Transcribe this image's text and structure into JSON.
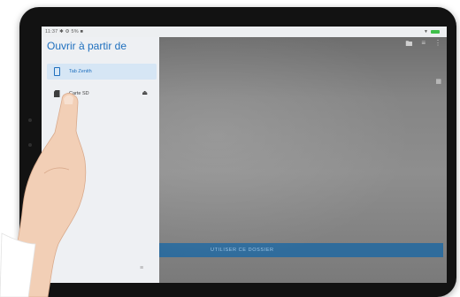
{
  "status_bar": {
    "time": "11:37",
    "indicators": "✱ ⚙ 5% ■"
  },
  "drawer": {
    "title": "Ouvrir à partir de",
    "items": [
      {
        "label": "Tab Zenith",
        "icon": "tablet-icon",
        "selected": true
      },
      {
        "label": "Carte SD",
        "icon": "sd-card-icon",
        "selected": false
      }
    ]
  },
  "content": {
    "use_folder_button": "UTILISER CE DOSSIER"
  },
  "colors": {
    "accent": "#1e6fbe",
    "selected_item_bg": "#d6e6f5",
    "use_folder_bar": "#2f6c9c"
  }
}
